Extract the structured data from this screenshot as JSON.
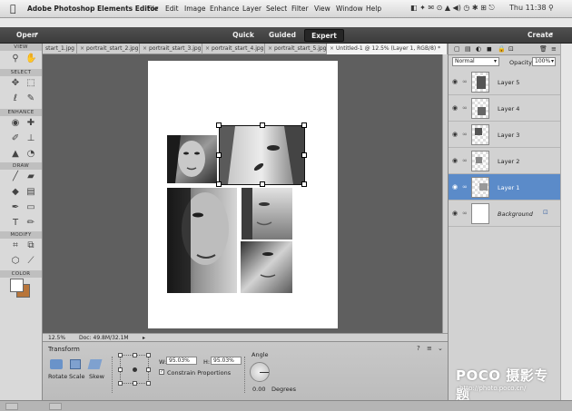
{
  "menubar": {
    "app_title": "Adobe Photoshop Elements Editor",
    "items": [
      "File",
      "Edit",
      "Image",
      "Enhance",
      "Layer",
      "Select",
      "Filter",
      "View",
      "Window",
      "Help"
    ],
    "clock": "Thu 11:38"
  },
  "optbar": {
    "open_label": "Open",
    "modes": [
      "Quick",
      "Guided",
      "Expert"
    ],
    "active_mode": "Expert",
    "create_label": "Create"
  },
  "toolbox": {
    "sections": [
      "VIEW",
      "SELECT",
      "ENHANCE",
      "DRAW",
      "MODIFY",
      "COLOR"
    ],
    "colors": {
      "foreground": "#ffffff",
      "background": "#b8753a"
    }
  },
  "tabs": [
    {
      "label": "start_1.jpg"
    },
    {
      "label": "portrait_start_2.jpg"
    },
    {
      "label": "portrait_start_3.jpg"
    },
    {
      "label": "portrait_start_4.jpg"
    },
    {
      "label": "portrait_start_5.jpg"
    },
    {
      "label": "Untitled-1 @ 12.5% (Layer 1, RGB/8) *"
    }
  ],
  "status": {
    "zoom": "12.5%",
    "doc": "Doc: 49.8M/32.1M"
  },
  "transform": {
    "title": "Transform",
    "actions": [
      "Rotate",
      "Scale",
      "Skew"
    ],
    "w_label": "W:",
    "w_value": "95.03%",
    "h_label": "H:",
    "h_value": "95.03%",
    "constrain_label": "Constrain Proportions",
    "angle_label": "Angle",
    "angle_value": "0.00",
    "degrees_label": "Degrees"
  },
  "layers_panel": {
    "blend_mode": "Normal",
    "opacity_label": "Opacity:",
    "opacity_value": "100%",
    "layers": [
      "Layer 5",
      "Layer 4",
      "Layer 3",
      "Layer 2",
      "Layer 1",
      "Background"
    ],
    "selected": "Layer 1"
  },
  "watermark": {
    "brand": "POCO 摄影专题",
    "url": "http://photo.poco.cn/"
  }
}
